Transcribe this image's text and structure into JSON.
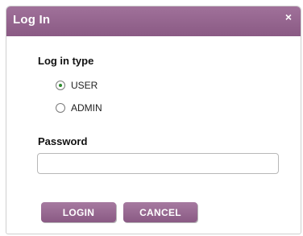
{
  "dialog": {
    "title": "Log In",
    "close_glyph": "×"
  },
  "login_type": {
    "label": "Log in type",
    "options": [
      {
        "label": "USER",
        "selected": true
      },
      {
        "label": "ADMIN",
        "selected": false
      }
    ]
  },
  "password": {
    "label": "Password",
    "value": "",
    "placeholder": ""
  },
  "buttons": {
    "login_label": "LOGIN",
    "cancel_label": "CANCEL"
  },
  "colors": {
    "accent": "#8a5a84",
    "radio_selected": "#2e8b2e"
  },
  "icons": {
    "close": "close-icon"
  }
}
